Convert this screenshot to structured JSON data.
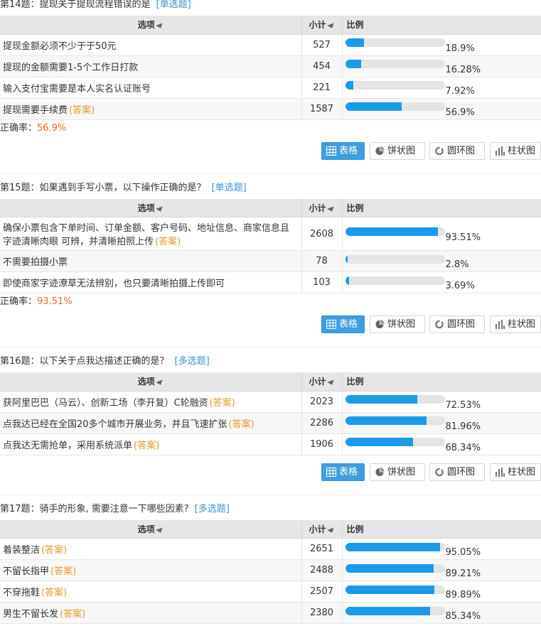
{
  "labels": {
    "col_option": "选项",
    "col_count": "小计",
    "col_percent": "比例",
    "answer_tag": "(答案)",
    "accuracy_label": "正确率：",
    "btn_table": "表格",
    "btn_pie": "饼状图",
    "btn_ring": "圆环图",
    "btn_bar": "柱状图"
  },
  "questions": [
    {
      "title": "第14题：提现关于提现流程错误的是",
      "type": "[单选题]",
      "options": [
        {
          "text": "提现金额必须不少于于50元",
          "answer": false,
          "count": "527",
          "percent": "18.9%",
          "fraction": 0.189
        },
        {
          "text": "提现的金额需要1-5个工作日打款",
          "answer": false,
          "count": "454",
          "percent": "16.28%",
          "fraction": 0.1628
        },
        {
          "text": "输入支付宝需要是本人实名认证账号",
          "answer": false,
          "count": "221",
          "percent": "7.92%",
          "fraction": 0.0792
        },
        {
          "text": "提现需要手续费",
          "answer": true,
          "count": "1587",
          "percent": "56.9%",
          "fraction": 0.569
        }
      ],
      "accuracy": "56.9%"
    },
    {
      "title": "第15题：如果遇到手写小票，以下操作正确的是？",
      "type": "[单选题]",
      "options": [
        {
          "text": "确保小票包含下单时间、订单金额、客户号码、地址信息、商家信息且字迹清晰肉眼 可辨，并清晰拍照上传",
          "answer": true,
          "count": "2608",
          "percent": "93.51%",
          "fraction": 0.9351
        },
        {
          "text": "不需要拍摄小票",
          "answer": false,
          "count": "78",
          "percent": "2.8%",
          "fraction": 0.028
        },
        {
          "text": "即使商家字迹潦草无法辨别，也只要清晰拍摄上传即可",
          "answer": false,
          "count": "103",
          "percent": "3.69%",
          "fraction": 0.0369
        }
      ],
      "accuracy": "93.51%"
    },
    {
      "title": "第16题：以下关于点我达描述正确的是？",
      "type": "[多选题]",
      "options": [
        {
          "text": "获阿里巴巴（马云）、创新工场（李开复）C轮融资",
          "answer": true,
          "count": "2023",
          "percent": "72.53%",
          "fraction": 0.7253
        },
        {
          "text": "点我达已经在全国20多个城市开展业务，并且飞速扩张",
          "answer": true,
          "count": "2286",
          "percent": "81.96%",
          "fraction": 0.8196
        },
        {
          "text": "点我达无需抢单，采用系统派单",
          "answer": true,
          "count": "1906",
          "percent": "68.34%",
          "fraction": 0.6834
        }
      ]
    },
    {
      "title": "第17题：骑手的形象, 需要注意一下哪些因素?",
      "type": "[多选题]",
      "options": [
        {
          "text": "着装整洁",
          "answer": true,
          "count": "2651",
          "percent": "95.05%",
          "fraction": 0.9505
        },
        {
          "text": "不留长指甲",
          "answer": true,
          "count": "2488",
          "percent": "89.21%",
          "fraction": 0.8921
        },
        {
          "text": "不穿拖鞋",
          "answer": true,
          "count": "2507",
          "percent": "89.89%",
          "fraction": 0.8989
        },
        {
          "text": "男生不留长发",
          "answer": true,
          "count": "2380",
          "percent": "85.34%",
          "fraction": 0.8534
        }
      ]
    }
  ]
}
